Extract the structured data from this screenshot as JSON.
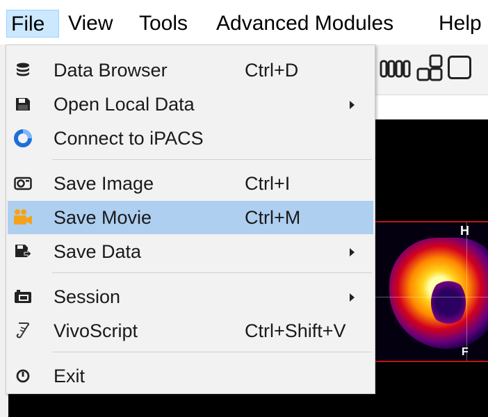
{
  "menubar": {
    "items": [
      {
        "label": "File"
      },
      {
        "label": "View"
      },
      {
        "label": "Tools"
      },
      {
        "label": "Advanced Modules"
      },
      {
        "label": "Help"
      }
    ],
    "active_index": 0
  },
  "file_menu": {
    "items": [
      {
        "label": "Data Browser",
        "shortcut": "Ctrl+D",
        "icon": "database-icon",
        "submenu": false
      },
      {
        "label": "Open Local Data",
        "shortcut": "",
        "icon": "floppy-disk-icon",
        "submenu": true
      },
      {
        "label": "Connect to iPACS",
        "shortcut": "",
        "icon": "ipacs-ring-icon",
        "submenu": false
      },
      {
        "label": "Save Image",
        "shortcut": "Ctrl+I",
        "icon": "camera-icon",
        "submenu": false
      },
      {
        "label": "Save Movie",
        "shortcut": "Ctrl+M",
        "icon": "video-camera-icon",
        "submenu": false,
        "highlighted": true
      },
      {
        "label": "Save Data",
        "shortcut": "",
        "icon": "save-data-icon",
        "submenu": true
      },
      {
        "label": "Session",
        "shortcut": "",
        "icon": "session-icon",
        "submenu": true
      },
      {
        "label": "VivoScript",
        "shortcut": "Ctrl+Shift+V",
        "icon": "script-scroll-icon",
        "submenu": false
      },
      {
        "label": "Exit",
        "shortcut": "",
        "icon": "power-icon",
        "submenu": false
      }
    ]
  },
  "viewer": {
    "orientation_top": "H",
    "orientation_bottom": "F"
  },
  "colors": {
    "menu_highlight": "#aecff0",
    "menubar_active": "#cce8ff",
    "ipacs_blue": "#1e6fd9",
    "movie_orange": "#f5a21b",
    "frame_red": "#c0141b"
  }
}
